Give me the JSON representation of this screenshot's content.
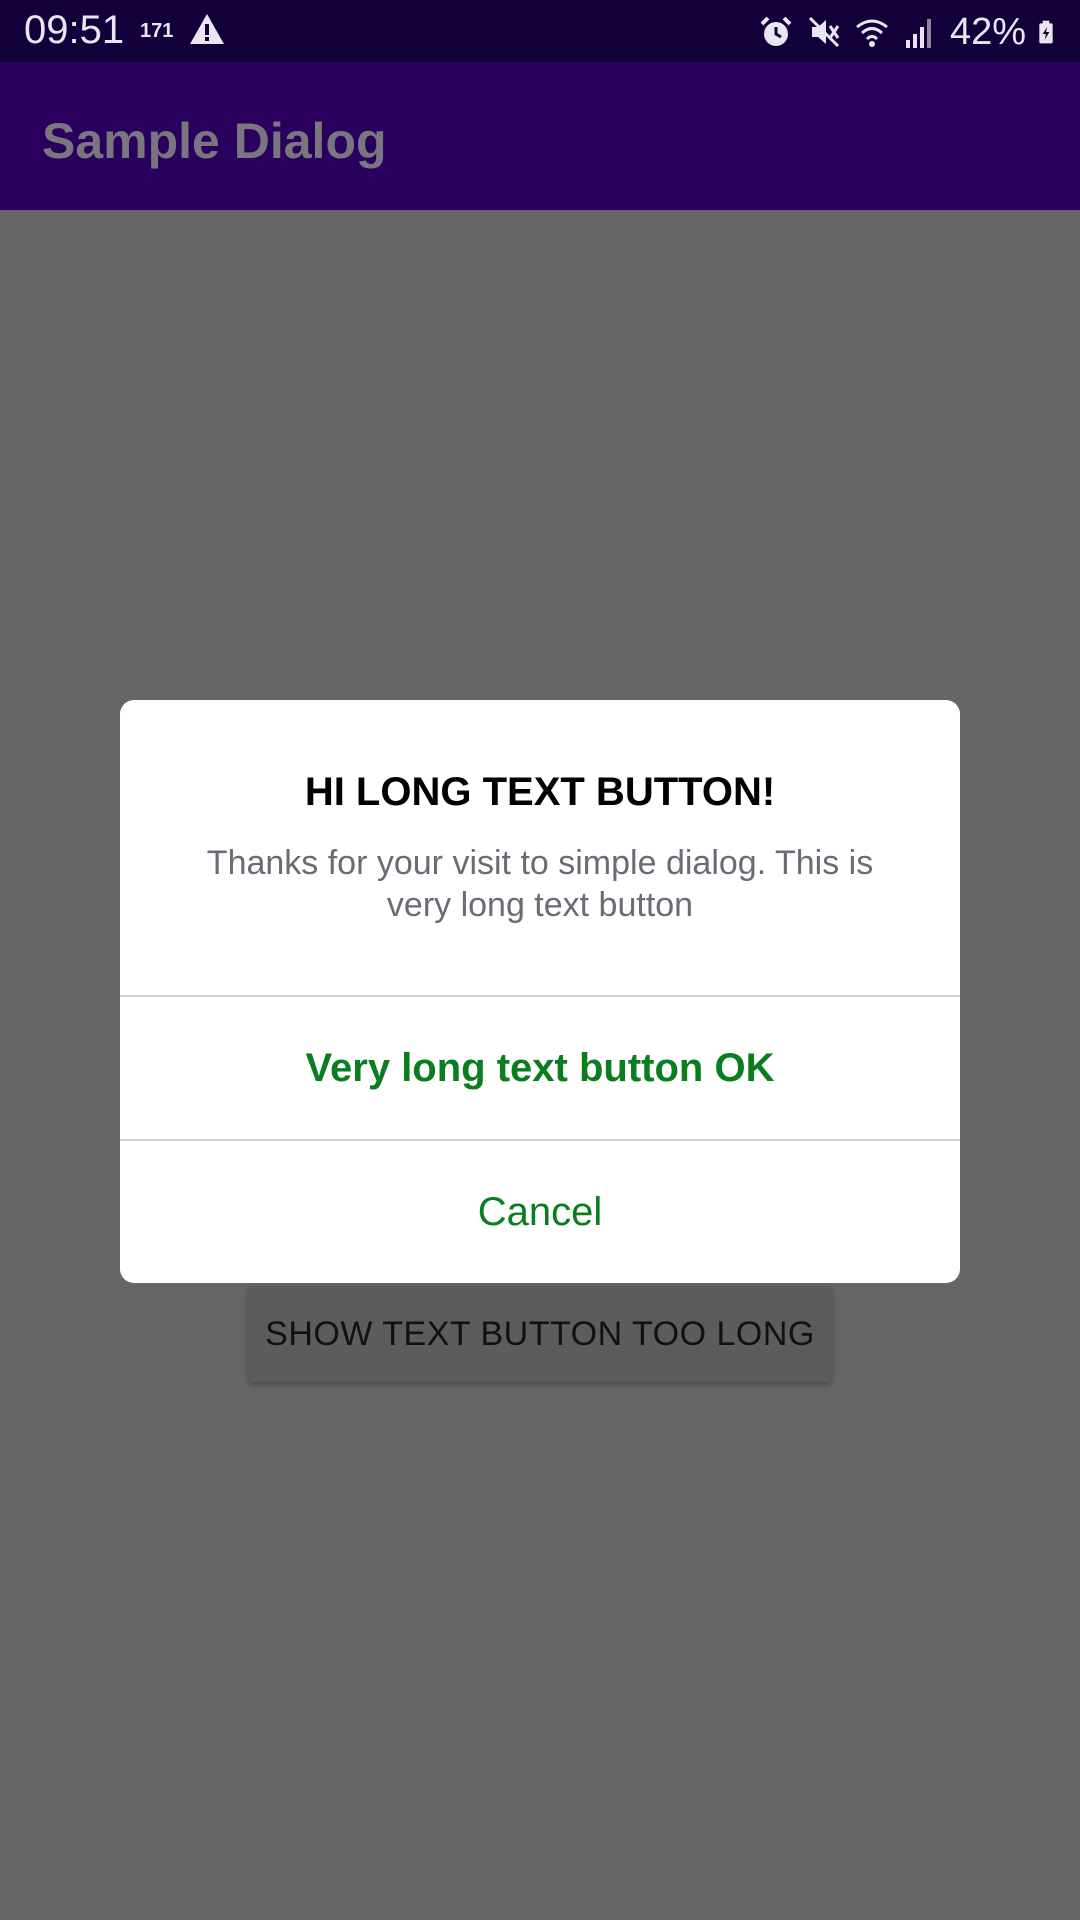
{
  "status_bar": {
    "time": "09:51",
    "notification_count": "171",
    "battery_percent": "42%",
    "icons": [
      "warning-icon",
      "alarm-icon",
      "mute-icon",
      "wifi-icon",
      "signal-icon",
      "battery-charging-icon"
    ]
  },
  "app_bar": {
    "title": "Sample Dialog"
  },
  "main": {
    "show_button_label": "SHOW TEXT BUTTON TOO LONG"
  },
  "dialog": {
    "title": "HI LONG TEXT BUTTON!",
    "message": "Thanks for your visit to simple dialog. This is very long text button",
    "ok_label": "Very long text button OK",
    "cancel_label": "Cancel"
  },
  "colors": {
    "status_bar": "#12003a",
    "app_bar": "#2a005e",
    "scrim_background": "#666666",
    "button_text": "#0a7d1e"
  }
}
